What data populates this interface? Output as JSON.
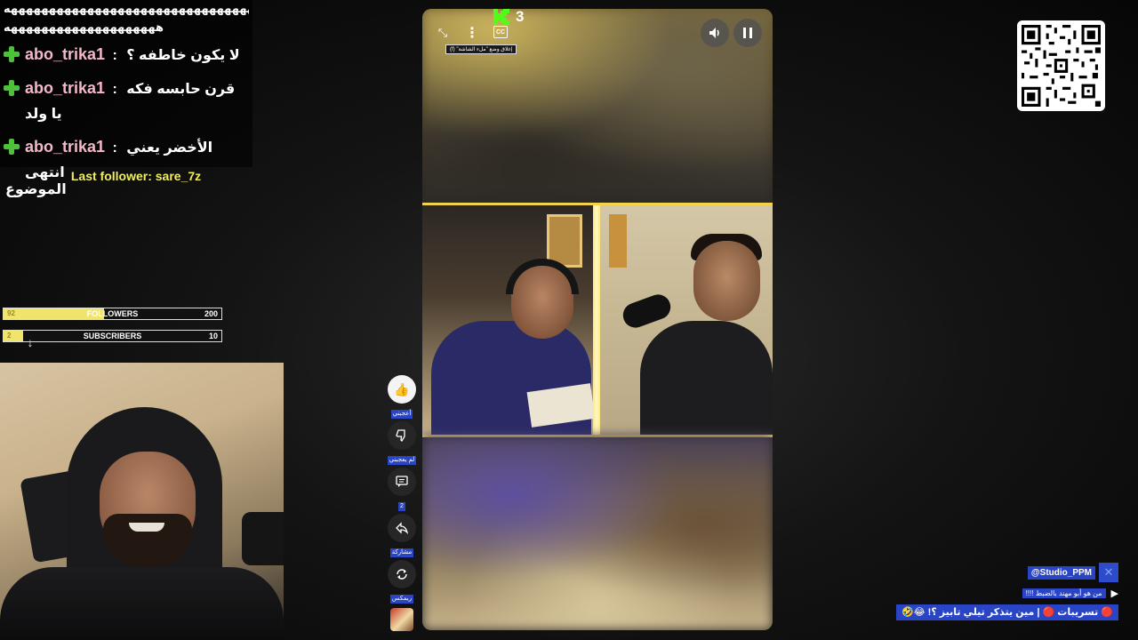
{
  "chat": {
    "spam_line_1": "ههههههههههههههههههههههههههههههههههه",
    "spam_line_2": "ههههههههههههههههههههه",
    "messages": [
      {
        "user": "abo_trika1",
        "text": "لا يكون خاطفه ؟"
      },
      {
        "user": "abo_trika1",
        "text": "قرن حابسه فكه يا ولد"
      },
      {
        "user": "abo_trika1",
        "text": "الأخضر يعني انتهى",
        "text_cont": "الموضوع"
      }
    ],
    "separator": ":"
  },
  "last_follower": "Last follower: sare_7z",
  "goals": [
    {
      "label": "FOLLOWERS",
      "current": "92",
      "target": "200",
      "progress": 0.46
    },
    {
      "label": "SUBSCRIBERS",
      "current": "2",
      "target": "10",
      "progress": 0.09
    }
  ],
  "video": {
    "viewer_count": "3",
    "tooltip": "إغلاق وضع \"ملء الشاشة\" (f)",
    "cc_label": "CC",
    "icons": {
      "exit_fullscreen": "exit-fullscreen-icon",
      "more": "more-vert-icon",
      "volume": "volume-icon",
      "pause": "pause-icon"
    }
  },
  "rail": {
    "like_label": "أعجبني",
    "dislike_label": "لم يعجبني",
    "comments_count": "2",
    "share_label": "مشاركة",
    "remix_label": "ريمكس"
  },
  "studio": {
    "handle": "@Studio_PPM"
  },
  "now_playing": {
    "text": "من هو أبو مهند بالضبط !!!!",
    "play_icon": "play-icon"
  },
  "ticker": {
    "text": "🔴 تسريبات 🔴 | مين يتذكر تيلي تابيز ؟! 😂🤣"
  },
  "colors": {
    "accent_blue": "#2944c4",
    "kick_green": "#53fc18",
    "badge_green": "#4ec13a",
    "username_pink": "#f4b8c8",
    "follower_yellow": "#f1ee5e",
    "goal_fill": "#f1e46a",
    "frame_yellow": "#f2d34b"
  }
}
